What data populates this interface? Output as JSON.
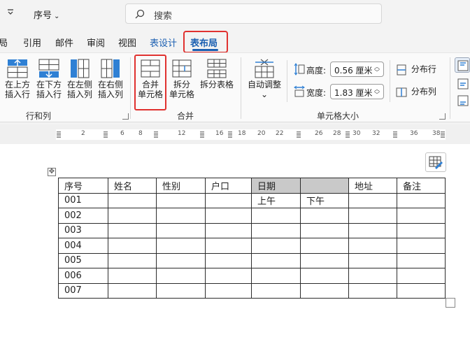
{
  "title_bar": {
    "quick_access_label": "≡",
    "doc_title": "序号",
    "search_placeholder": "搜索"
  },
  "tabs": [
    "局",
    "引用",
    "邮件",
    "审阅",
    "视图",
    "表设计",
    "表布局"
  ],
  "active_tab": "表布局",
  "ribbon": {
    "rows_cols": {
      "group_label": "行和列",
      "buttons": [
        {
          "line1": "在上方",
          "line2": "插入行"
        },
        {
          "line1": "在下方",
          "line2": "插入行"
        },
        {
          "line1": "在左侧",
          "line2": "插入列"
        },
        {
          "line1": "在右侧",
          "line2": "插入列"
        }
      ]
    },
    "merge": {
      "group_label": "合并",
      "merge_cells": {
        "line1": "合并",
        "line2": "单元格"
      },
      "split_cells": {
        "line1": "拆分",
        "line2": "单元格"
      },
      "split_table": "拆分表格"
    },
    "cell_size": {
      "group_label": "单元格大小",
      "autofit": "自动调整",
      "autofit_arrow": "⌄",
      "height_label": "高度:",
      "height_value": "0.56 厘米",
      "width_label": "宽度:",
      "width_value": "1.83 厘米",
      "distribute_rows": "分布行",
      "distribute_cols": "分布列"
    }
  },
  "ruler": {
    "ticks": [
      "2",
      "6",
      "8",
      "12",
      "16",
      "18",
      "20",
      "22",
      "26",
      "28",
      "30",
      "32",
      "36",
      "38"
    ]
  },
  "table": {
    "header": [
      "序号",
      "姓名",
      "性别",
      "户口",
      "日期",
      "",
      "地址",
      "备注"
    ],
    "rows": [
      [
        "001",
        "",
        "",
        "",
        "上午",
        "下午",
        "",
        ""
      ],
      [
        "002",
        "",
        "",
        "",
        "",
        "",
        "",
        ""
      ],
      [
        "003",
        "",
        "",
        "",
        "",
        "",
        "",
        ""
      ],
      [
        "004",
        "",
        "",
        "",
        "",
        "",
        "",
        ""
      ],
      [
        "005",
        "",
        "",
        "",
        "",
        "",
        "",
        ""
      ],
      [
        "006",
        "",
        "",
        "",
        "",
        "",
        "",
        ""
      ],
      [
        "007",
        "",
        "",
        "",
        "",
        "",
        "",
        ""
      ]
    ],
    "selected_cells": "header columns 5-6"
  },
  "colors": {
    "accent": "#1b5fb1",
    "highlight": "#e0312f",
    "selection": "#c9c9c9"
  }
}
